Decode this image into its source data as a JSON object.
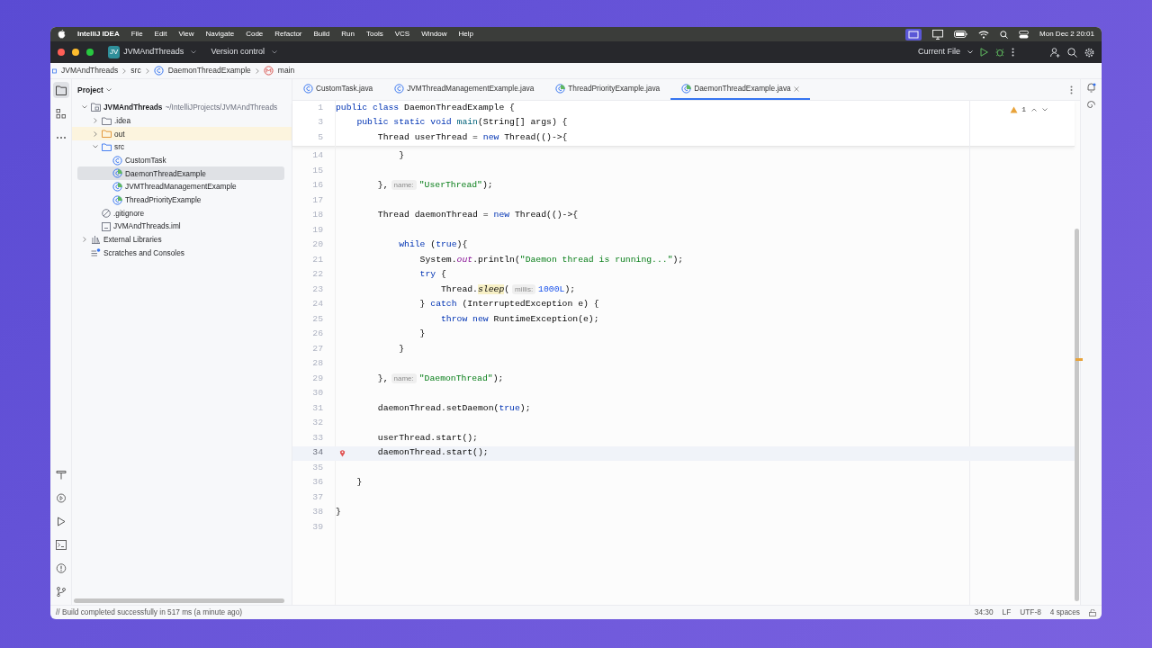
{
  "menubar": {
    "app": "IntelliJ IDEA",
    "menus": [
      "File",
      "Edit",
      "View",
      "Navigate",
      "Code",
      "Refactor",
      "Build",
      "Run",
      "Tools",
      "VCS",
      "Window",
      "Help"
    ],
    "clock": "Mon Dec 2  20:01"
  },
  "toolbar": {
    "project_badge": "JV",
    "project": "JVMAndThreads",
    "vcs": "Version control",
    "run_config": "Current File"
  },
  "breadcrumbs": [
    {
      "kind": "module",
      "text": "JVMAndThreads"
    },
    {
      "kind": "folder",
      "text": "src"
    },
    {
      "kind": "class",
      "text": "DaemonThreadExample"
    },
    {
      "kind": "method",
      "text": "main"
    }
  ],
  "project_panel": {
    "title": "Project",
    "tree": [
      {
        "kind": "module",
        "text": "JVMAndThreads",
        "path": "~/IntelliJProjects/JVMAndThreads",
        "expanded": true,
        "selected": false,
        "children": [
          {
            "kind": "folder",
            "text": ".idea",
            "expanded": false,
            "selected": false
          },
          {
            "kind": "excluded_folder",
            "text": "out",
            "expanded": false,
            "selected": false
          },
          {
            "kind": "source_folder",
            "text": "src",
            "expanded": true,
            "selected": false,
            "children": [
              {
                "kind": "class",
                "text": "CustomTask",
                "selected": false
              },
              {
                "kind": "main_class",
                "text": "DaemonThreadExample",
                "selected": true
              },
              {
                "kind": "main_class",
                "text": "JVMThreadManagementExample",
                "selected": false
              },
              {
                "kind": "main_class",
                "text": "ThreadPriorityExample",
                "selected": false
              }
            ]
          },
          {
            "kind": "ignore_file",
            "text": ".gitignore",
            "selected": false
          },
          {
            "kind": "module_file",
            "text": "JVMAndThreads.iml",
            "selected": false
          }
        ]
      },
      {
        "kind": "libraries",
        "text": "External Libraries",
        "expanded": false,
        "selected": false
      },
      {
        "kind": "scratches",
        "text": "Scratches and Consoles",
        "selected": false
      }
    ]
  },
  "tabs": [
    {
      "kind": "class",
      "label": "CustomTask.java",
      "selected": false
    },
    {
      "kind": "class",
      "label": "JVMThreadManagementExample.java",
      "selected": false
    },
    {
      "kind": "main_class",
      "label": "ThreadPriorityExample.java",
      "selected": false
    },
    {
      "kind": "main_class",
      "label": "DaemonThreadExample.java",
      "selected": true
    }
  ],
  "inspections": {
    "warnings": "1"
  },
  "sticky_lines": [
    {
      "num": "1",
      "tokens": [
        {
          "kind": "kw",
          "text": "public class "
        },
        {
          "kind": "plain",
          "text": "DaemonThreadExample {"
        }
      ]
    },
    {
      "num": "3",
      "tokens": [
        {
          "kind": "kw",
          "text": "public static void "
        },
        {
          "kind": "method",
          "text": "main"
        },
        {
          "kind": "plain",
          "text": "(String[] args) {"
        }
      ]
    },
    {
      "num": "5",
      "tokens": [
        {
          "kind": "plain",
          "text": "Thread userThread = "
        },
        {
          "kind": "kw",
          "text": "new"
        },
        {
          "kind": "plain",
          "text": " Thread(()->{"
        }
      ]
    }
  ],
  "lines": [
    {
      "num": "14",
      "current": false,
      "breakpoint": false,
      "tokens": [
        {
          "kind": "plain",
          "text": "}"
        }
      ]
    },
    {
      "num": "15",
      "current": false,
      "breakpoint": false
    },
    {
      "num": "16",
      "current": false,
      "breakpoint": false,
      "tokens": [
        {
          "kind": "plain",
          "text": "},"
        },
        {
          "kind": "hint",
          "text": "name:"
        },
        {
          "kind": "str",
          "text": "\"UserThread\""
        },
        {
          "kind": "plain",
          "text": ");"
        }
      ]
    },
    {
      "num": "17",
      "current": false,
      "breakpoint": false
    },
    {
      "num": "18",
      "current": false,
      "breakpoint": false,
      "tokens": [
        {
          "kind": "plain",
          "text": "Thread daemonThread = "
        },
        {
          "kind": "kw",
          "text": "new"
        },
        {
          "kind": "plain",
          "text": " Thread(()->{"
        }
      ]
    },
    {
      "num": "19",
      "current": false,
      "breakpoint": false
    },
    {
      "num": "20",
      "current": false,
      "breakpoint": false,
      "tokens": [
        {
          "kind": "kw",
          "text": "while"
        },
        {
          "kind": "plain",
          "text": " ("
        },
        {
          "kind": "kw",
          "text": "true"
        },
        {
          "kind": "plain",
          "text": "){"
        }
      ]
    },
    {
      "num": "21",
      "current": false,
      "breakpoint": false,
      "tokens": [
        {
          "kind": "plain",
          "text": "System."
        },
        {
          "kind": "field",
          "text": "out"
        },
        {
          "kind": "plain",
          "text": ".println("
        },
        {
          "kind": "str",
          "text": "\"Daemon thread is running...\""
        },
        {
          "kind": "plain",
          "text": ");"
        }
      ]
    },
    {
      "num": "22",
      "current": false,
      "breakpoint": false,
      "tokens": [
        {
          "kind": "kw",
          "text": "try"
        },
        {
          "kind": "plain",
          "text": " {"
        }
      ]
    },
    {
      "num": "23",
      "current": false,
      "breakpoint": false,
      "tokens": [
        {
          "kind": "plain",
          "text": "Thread."
        },
        {
          "kind": "static_hl",
          "text": "sleep"
        },
        {
          "kind": "plain",
          "text": "("
        },
        {
          "kind": "hint",
          "text": "millis:"
        },
        {
          "kind": "num",
          "text": "1000L"
        },
        {
          "kind": "plain",
          "text": ");"
        }
      ]
    },
    {
      "num": "24",
      "current": false,
      "breakpoint": false,
      "tokens": [
        {
          "kind": "plain",
          "text": "} "
        },
        {
          "kind": "kw",
          "text": "catch"
        },
        {
          "kind": "plain",
          "text": " (InterruptedException e) {"
        }
      ]
    },
    {
      "num": "25",
      "current": false,
      "breakpoint": false,
      "tokens": [
        {
          "kind": "kw",
          "text": "throw new"
        },
        {
          "kind": "plain",
          "text": " RuntimeException(e);"
        }
      ]
    },
    {
      "num": "26",
      "current": false,
      "breakpoint": false,
      "tokens": [
        {
          "kind": "plain",
          "text": "}"
        }
      ]
    },
    {
      "num": "27",
      "current": false,
      "breakpoint": false,
      "tokens": [
        {
          "kind": "plain",
          "text": "}"
        }
      ]
    },
    {
      "num": "28",
      "current": false,
      "breakpoint": false
    },
    {
      "num": "29",
      "current": false,
      "breakpoint": false,
      "tokens": [
        {
          "kind": "plain",
          "text": "},"
        },
        {
          "kind": "hint",
          "text": "name:"
        },
        {
          "kind": "str",
          "text": "\"DaemonThread\""
        },
        {
          "kind": "plain",
          "text": ");"
        }
      ]
    },
    {
      "num": "30",
      "current": false,
      "breakpoint": false
    },
    {
      "num": "31",
      "current": false,
      "breakpoint": false,
      "tokens": [
        {
          "kind": "plain",
          "text": "daemonThread.setDaemon("
        },
        {
          "kind": "kw",
          "text": "true"
        },
        {
          "kind": "plain",
          "text": ");"
        }
      ]
    },
    {
      "num": "32",
      "current": false,
      "breakpoint": false
    },
    {
      "num": "33",
      "current": false,
      "breakpoint": false,
      "tokens": [
        {
          "kind": "plain",
          "text": "userThread.start();"
        }
      ]
    },
    {
      "num": "34",
      "current": true,
      "breakpoint": true,
      "tokens": [
        {
          "kind": "plain",
          "text": "daemonThread.start();"
        }
      ]
    },
    {
      "num": "35",
      "current": false,
      "breakpoint": false
    },
    {
      "num": "36",
      "current": false,
      "breakpoint": false,
      "tokens": [
        {
          "kind": "plain",
          "text": "}"
        }
      ]
    },
    {
      "num": "37",
      "current": false,
      "breakpoint": false
    },
    {
      "num": "38",
      "current": false,
      "breakpoint": false,
      "tokens": [
        {
          "kind": "plain",
          "text": "}"
        }
      ]
    },
    {
      "num": "39",
      "current": false,
      "breakpoint": false
    }
  ],
  "status_bar": {
    "message": "// Build completed successfully in 517 ms (a minute ago)",
    "position": "34:30",
    "line_separator": "LF",
    "encoding": "UTF-8",
    "indent": "4 spaces"
  }
}
